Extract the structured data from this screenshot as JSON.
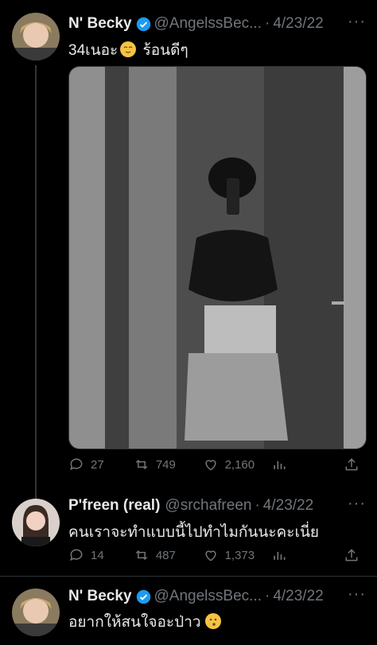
{
  "tweets": [
    {
      "name": "N' Becky",
      "handle": "@AngelssBec...",
      "date": "4/23/22",
      "text": "34เนอะ",
      "text_after": " ร้อนดีๆ",
      "replies": "27",
      "retweets": "749",
      "likes": "2,160"
    },
    {
      "name": "P'freen (real)",
      "handle": "@srchafreen",
      "date": "4/23/22",
      "text": "คนเราจะทำแบบนี้ไปทำไมกันนะคะเนี่ย",
      "replies": "14",
      "retweets": "487",
      "likes": "1,373"
    },
    {
      "name": "N' Becky",
      "handle": "@AngelssBec...",
      "date": "4/23/22",
      "text": "อยากให้สนใจอะป่าว"
    }
  ],
  "separator": "·",
  "more": "···",
  "colors": {
    "verified": "#1d9bf0",
    "muted": "#71767b",
    "text": "#e7e9ea",
    "bg": "#000000"
  }
}
